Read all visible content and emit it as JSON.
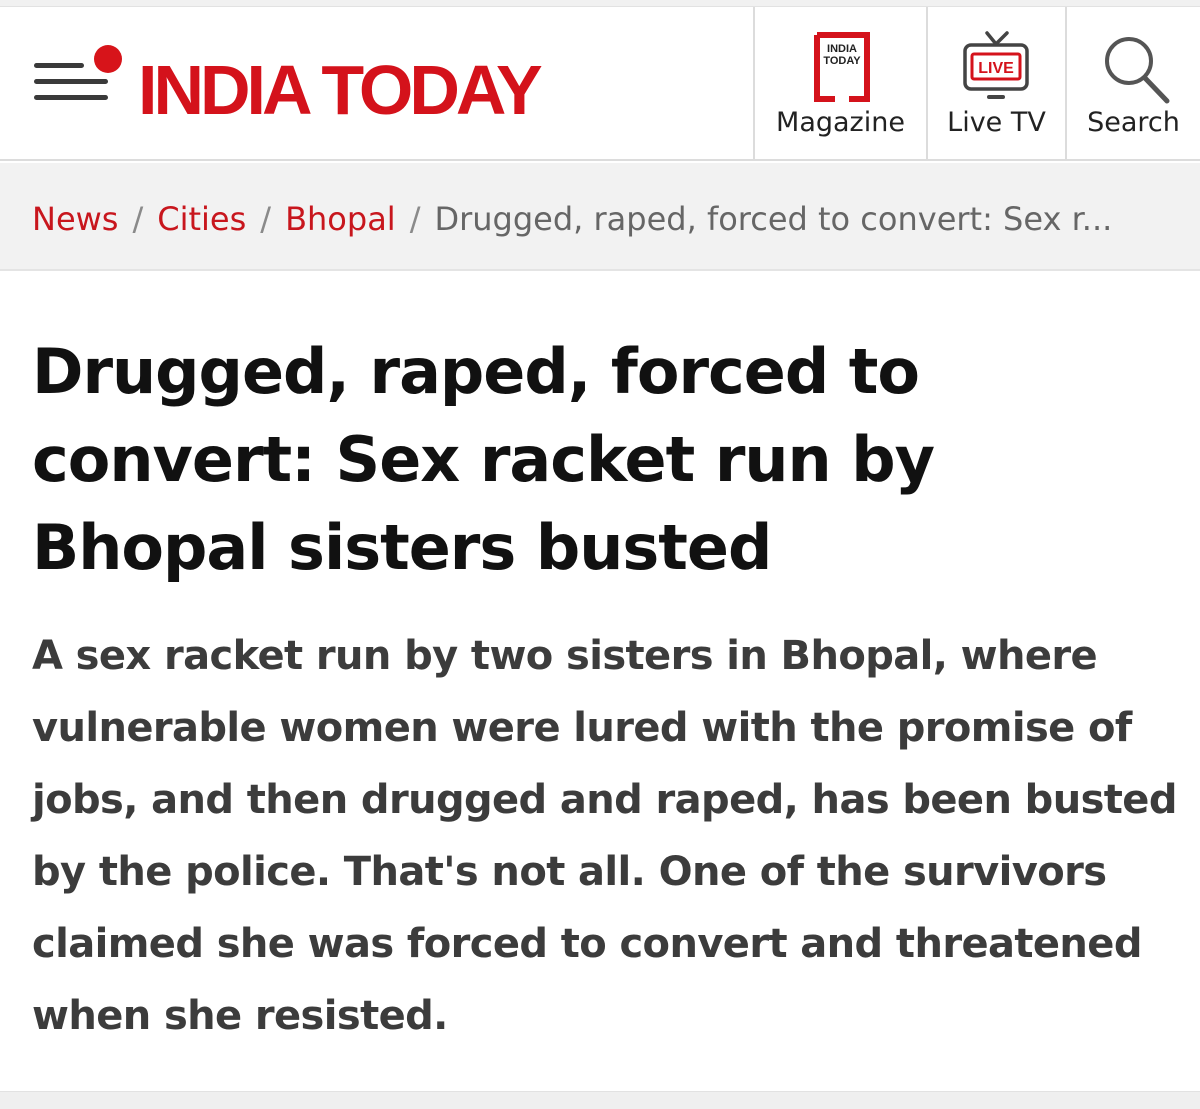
{
  "header": {
    "logo": "INDIA TODAY",
    "nav": [
      {
        "label": "Magazine",
        "icon": "magazine-icon",
        "icon_text_line1": "INDIA",
        "icon_text_line2": "TODAY"
      },
      {
        "label": "Live TV",
        "icon": "live-tv-icon",
        "icon_text": "LIVE"
      },
      {
        "label": "Search",
        "icon": "search-icon"
      }
    ]
  },
  "breadcrumb": {
    "items": [
      "News",
      "Cities",
      "Bhopal"
    ],
    "separator": "/",
    "current": "Drugged, raped, forced to convert: Sex r..."
  },
  "article": {
    "headline": "Drugged, raped, forced to convert: Sex racket run by Bhopal sisters busted",
    "summary": "A sex racket run by two sisters in Bhopal, where vulnerable women were lured with the promise of jobs, and then drugged and raped, has been busted by the police. That's not all. One of the survivors claimed she was forced to convert and threatened when she resisted."
  },
  "colors": {
    "brand_red": "#d4121b",
    "link_red": "#c8161d",
    "breadcrumb_bg": "#f2f2f2",
    "summary_text": "#3c3c3c"
  }
}
